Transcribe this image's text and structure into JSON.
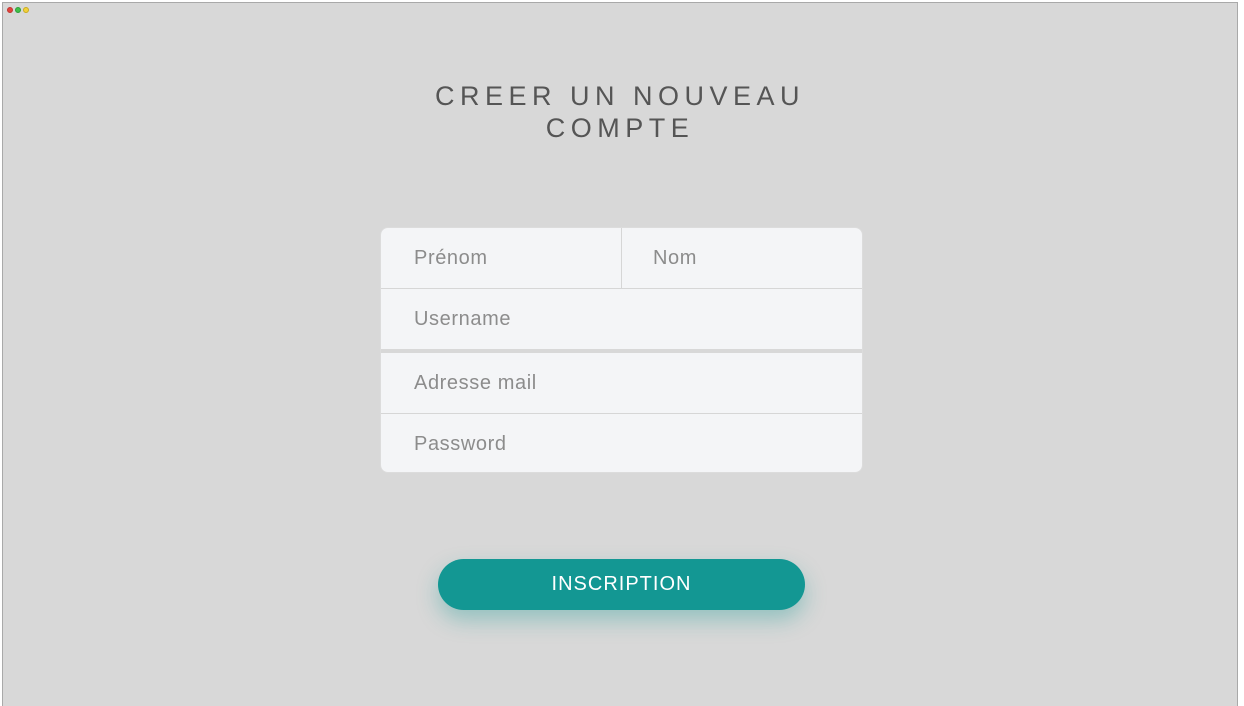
{
  "window": {
    "controls": [
      "close",
      "minimize",
      "zoom"
    ]
  },
  "page": {
    "title_line1": "CREER UN NOUVEAU",
    "title_line2": "COMPTE"
  },
  "form": {
    "first_name": {
      "placeholder": "Prénom",
      "value": ""
    },
    "last_name": {
      "placeholder": "Nom",
      "value": ""
    },
    "username": {
      "placeholder": "Username",
      "value": ""
    },
    "email": {
      "placeholder": "Adresse mail",
      "value": ""
    },
    "password": {
      "placeholder": "Password",
      "value": ""
    }
  },
  "actions": {
    "submit_label": "INSCRIPTION"
  },
  "colors": {
    "background": "#d8d8d8",
    "accent": "#139793",
    "form_bg": "#f4f5f7",
    "title": "#555555",
    "placeholder": "#8c8c8c"
  }
}
